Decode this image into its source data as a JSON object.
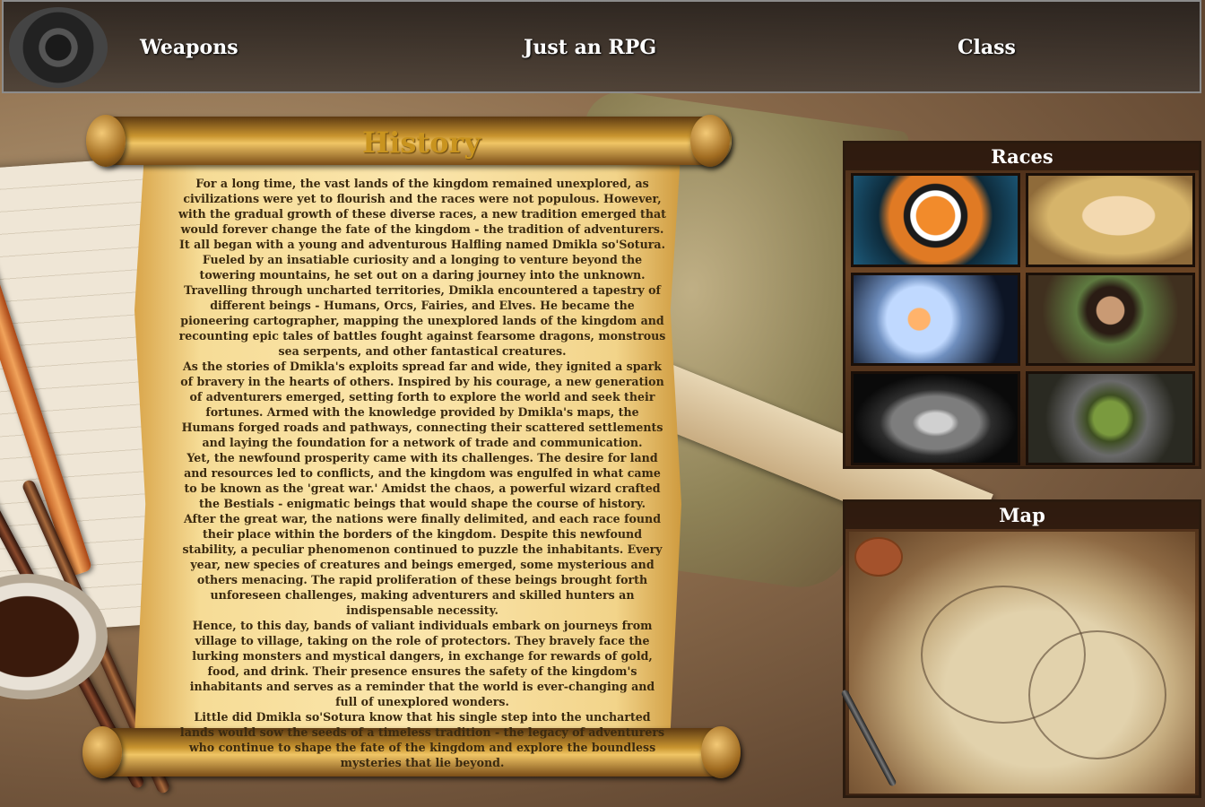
{
  "nav": {
    "weapons": "Weapons",
    "title": "Just an RPG",
    "class": "Class"
  },
  "history": {
    "title": "History",
    "paragraphs": [
      "For a long time, the vast lands of the kingdom remained unexplored, as civilizations were yet to flourish and the races were not populous. However, with the gradual growth of these diverse races, a new tradition emerged that would forever change the fate of the kingdom - the tradition of adventurers.",
      "It all began with a young and adventurous Halfling named Dmikla so'Sotura. Fueled by an insatiable curiosity and a longing to venture beyond the towering mountains, he set out on a daring journey into the unknown. Travelling through uncharted territories, Dmikla encountered a tapestry of different beings - Humans, Orcs, Fairies, and Elves. He became the pioneering cartographer, mapping the unexplored lands of the kingdom and recounting epic tales of battles fought against fearsome dragons, monstrous sea serpents, and other fantastical creatures.",
      "As the stories of Dmikla's exploits spread far and wide, they ignited a spark of bravery in the hearts of others. Inspired by his courage, a new generation of adventurers emerged, setting forth to explore the world and seek their fortunes. Armed with the knowledge provided by Dmikla's maps, the Humans forged roads and pathways, connecting their scattered settlements and laying the foundation for a network of trade and communication.",
      "Yet, the newfound prosperity came with its challenges. The desire for land and resources led to conflicts, and the kingdom was engulfed in what came to be known as the 'great war.' Amidst the chaos, a powerful wizard crafted the Bestials - enigmatic beings that would shape the course of history.",
      "After the great war, the nations were finally delimited, and each race found their place within the borders of the kingdom. Despite this newfound stability, a peculiar phenomenon continued to puzzle the inhabitants. Every year, new species of creatures and beings emerged, some mysterious and others menacing. The rapid proliferation of these beings brought forth unforeseen challenges, making adventurers and skilled hunters an indispensable necessity.",
      "Hence, to this day, bands of valiant individuals embark on journeys from village to village, taking on the role of protectors. They bravely face the lurking monsters and mystical dangers, in exchange for rewards of gold, food, and drink. Their presence ensures the safety of the kingdom's inhabitants and serves as a reminder that the world is ever-changing and full of unexplored wonders.",
      "Little did Dmikla so'Sotura know that his single step into the uncharted lands would sow the seeds of a timeless tradition - the legacy of adventurers who continue to shape the fate of the kingdom and explore the boundless mysteries that lie beyond."
    ]
  },
  "races": {
    "title": "Races",
    "images": [
      "tiger-bestial-image",
      "elf-image",
      "fairy-image",
      "halfling-image",
      "human-knight-image",
      "orc-image"
    ]
  },
  "map": {
    "title": "Map"
  },
  "colors": {
    "history_title": "#c9941f",
    "nav_text": "#ffffff",
    "panel_frame": "#4a2d18"
  }
}
